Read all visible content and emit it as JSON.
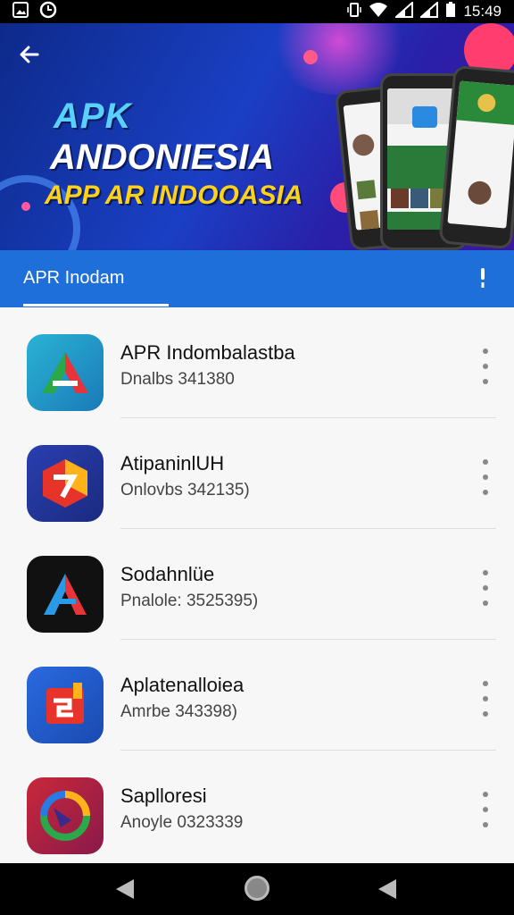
{
  "status_bar": {
    "time": "15:49"
  },
  "banner": {
    "title_line1": "APK",
    "title_line2": "ANDONIESIA",
    "title_line3": "APP AR INDOOASIA"
  },
  "tab": {
    "label": "APR Inodam"
  },
  "apps": [
    {
      "name": "APR Indombalastba",
      "subtitle": "Dnalbs 341380",
      "icon": "red-green-a-icon"
    },
    {
      "name": "AtipaninlUH",
      "subtitle": "Onlovbs 342135)",
      "icon": "orange-hex-icon"
    },
    {
      "name": "Sodahnlüe",
      "subtitle": "Pnalole: 3525395)",
      "icon": "blue-red-a-icon"
    },
    {
      "name": "Aplatenalloiea",
      "subtitle": "Amrbe 343398)",
      "icon": "red-box-icon"
    },
    {
      "name": "Saplloresi",
      "subtitle": "Anoyle 0323339",
      "icon": "circle-arrow-icon"
    }
  ],
  "colors": {
    "tab_bar": "#1e6fd9",
    "banner_bg": "#1a3fc4"
  }
}
